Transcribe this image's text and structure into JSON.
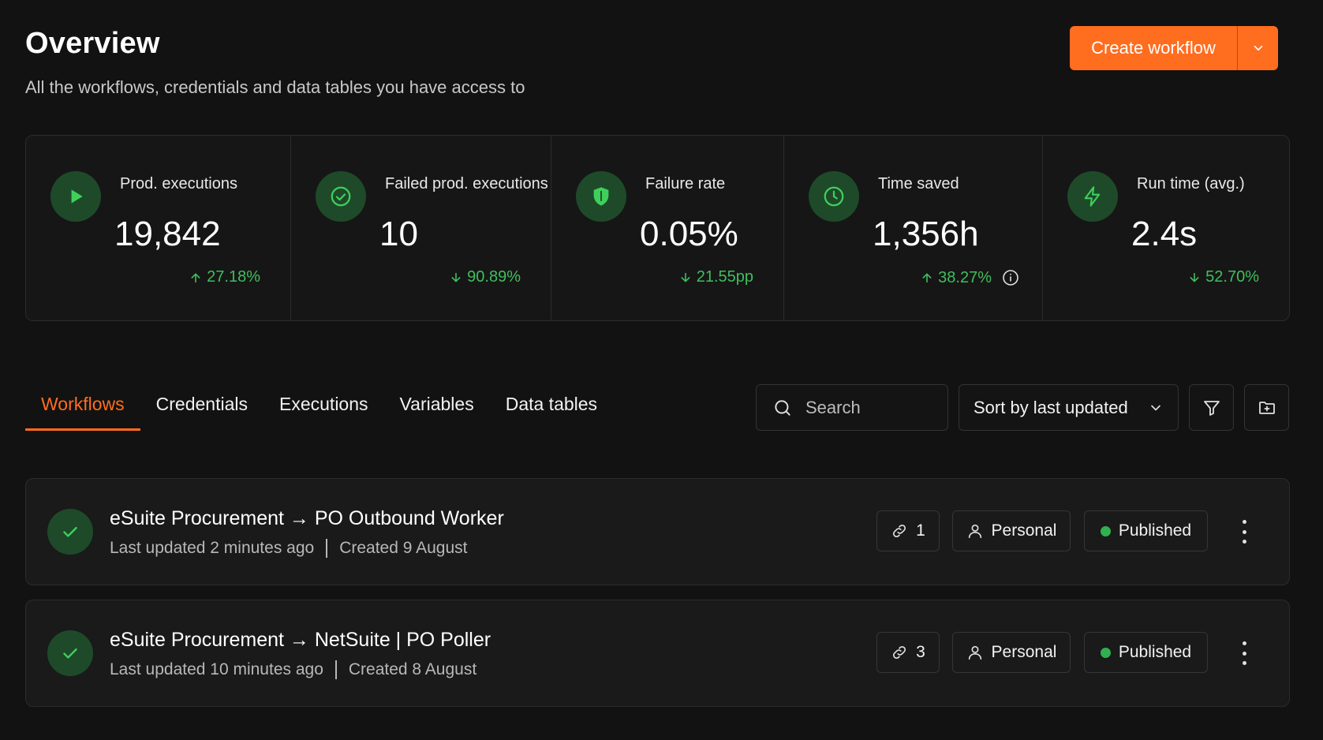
{
  "header": {
    "title": "Overview",
    "subtitle": "All the workflows, credentials and data tables you have access to",
    "create_label": "Create workflow"
  },
  "stats": [
    {
      "icon": "play-icon",
      "label": "Prod. executions",
      "value": "19,842",
      "delta": "27.18%",
      "direction": "up"
    },
    {
      "icon": "check-circle-icon",
      "label": "Failed prod. executions",
      "value": "10",
      "delta": "90.89%",
      "direction": "down"
    },
    {
      "icon": "shield-icon",
      "label": "Failure rate",
      "value": "0.05%",
      "delta": "21.55pp",
      "direction": "down"
    },
    {
      "icon": "clock-icon",
      "label": "Time saved",
      "value": "1,356h",
      "delta": "38.27%",
      "direction": "up"
    },
    {
      "icon": "lightning-icon",
      "label": "Run time (avg.)",
      "value": "2.4s",
      "delta": "52.70%",
      "direction": "down"
    }
  ],
  "tabs": [
    {
      "label": "Workflows",
      "active": true
    },
    {
      "label": "Credentials",
      "active": false
    },
    {
      "label": "Executions",
      "active": false
    },
    {
      "label": "Variables",
      "active": false
    },
    {
      "label": "Data tables",
      "active": false
    }
  ],
  "toolbar": {
    "search_placeholder": "Search",
    "sort_label": "Sort by last updated"
  },
  "workflows": [
    {
      "name": "eSuite Procurement → PO Outbound Worker",
      "updated": "Last updated 2 minutes ago",
      "created": "Created 9 August",
      "links": "1",
      "owner": "Personal",
      "status": "Published"
    },
    {
      "name": "eSuite Procurement → NetSuite | PO Poller",
      "updated": "Last updated 10 minutes ago",
      "created": "Created 8 August",
      "links": "3",
      "owner": "Personal",
      "status": "Published"
    }
  ],
  "colors": {
    "accent": "#ff6d1f",
    "success": "#3fbf5c",
    "icon_bg": "#1e4a2a"
  }
}
